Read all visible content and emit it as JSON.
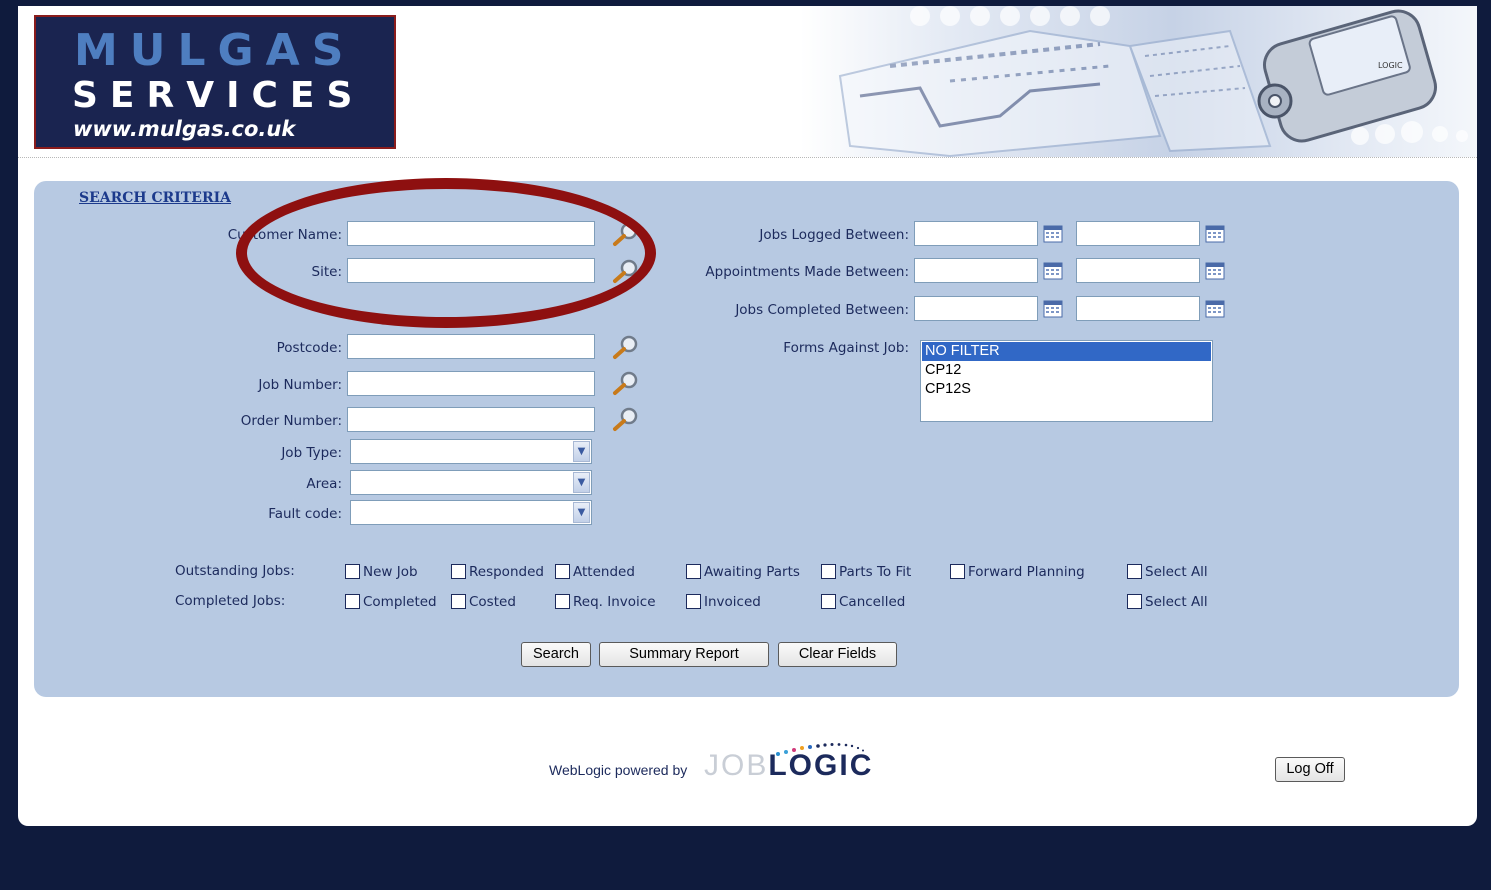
{
  "brand": {
    "line1": "MULGAS",
    "line2": "SERVICES",
    "line3": "www.mulgas.co.uk"
  },
  "banner": {
    "device_label": "LOGIC"
  },
  "search": {
    "title": "SEARCH CRITERIA",
    "left_fields": {
      "customer_name": {
        "label": "Customer Name:",
        "value": ""
      },
      "site": {
        "label": "Site:",
        "value": ""
      },
      "postcode": {
        "label": "Postcode:",
        "value": ""
      },
      "job_number": {
        "label": "Job Number:",
        "value": ""
      },
      "order_number": {
        "label": "Order Number:",
        "value": ""
      }
    },
    "selects": {
      "job_type": {
        "label": "Job Type:",
        "value": ""
      },
      "area": {
        "label": "Area:",
        "value": ""
      },
      "fault_code": {
        "label": "Fault code:",
        "value": ""
      }
    },
    "date_ranges": {
      "jobs_logged": {
        "label": "Jobs Logged Between:",
        "from": "",
        "to": ""
      },
      "appointments_made": {
        "label": "Appointments Made Between:",
        "from": "",
        "to": ""
      },
      "jobs_completed": {
        "label": "Jobs Completed Between:",
        "from": "",
        "to": ""
      }
    },
    "forms_against_job": {
      "label": "Forms Against Job:",
      "options": [
        "NO FILTER",
        "CP12",
        "CP12S"
      ],
      "selected": "NO FILTER"
    },
    "outstanding_jobs": {
      "label": "Outstanding Jobs:",
      "options": [
        "New Job",
        "Responded",
        "Attended",
        "Awaiting Parts",
        "Parts To Fit",
        "Forward Planning"
      ],
      "select_all": "Select All"
    },
    "completed_jobs": {
      "label": "Completed Jobs:",
      "options": [
        "Completed",
        "Costed",
        "Req. Invoice",
        "Invoiced",
        "Cancelled"
      ],
      "select_all": "Select All"
    },
    "buttons": {
      "search": "Search",
      "summary_report": "Summary Report",
      "clear_fields": "Clear Fields"
    }
  },
  "footer": {
    "powered_by": "WebLogic powered by",
    "logo_job": "JOB",
    "logo_logic": "LOGIC",
    "log_off": "Log Off"
  },
  "colors": {
    "page_background": "#0f1b3d",
    "panel": "#b7c9e2",
    "label_text": "#1c2a5c",
    "annotation_ellipse": "#8e1010",
    "listbox_selected": "#3168c6"
  }
}
